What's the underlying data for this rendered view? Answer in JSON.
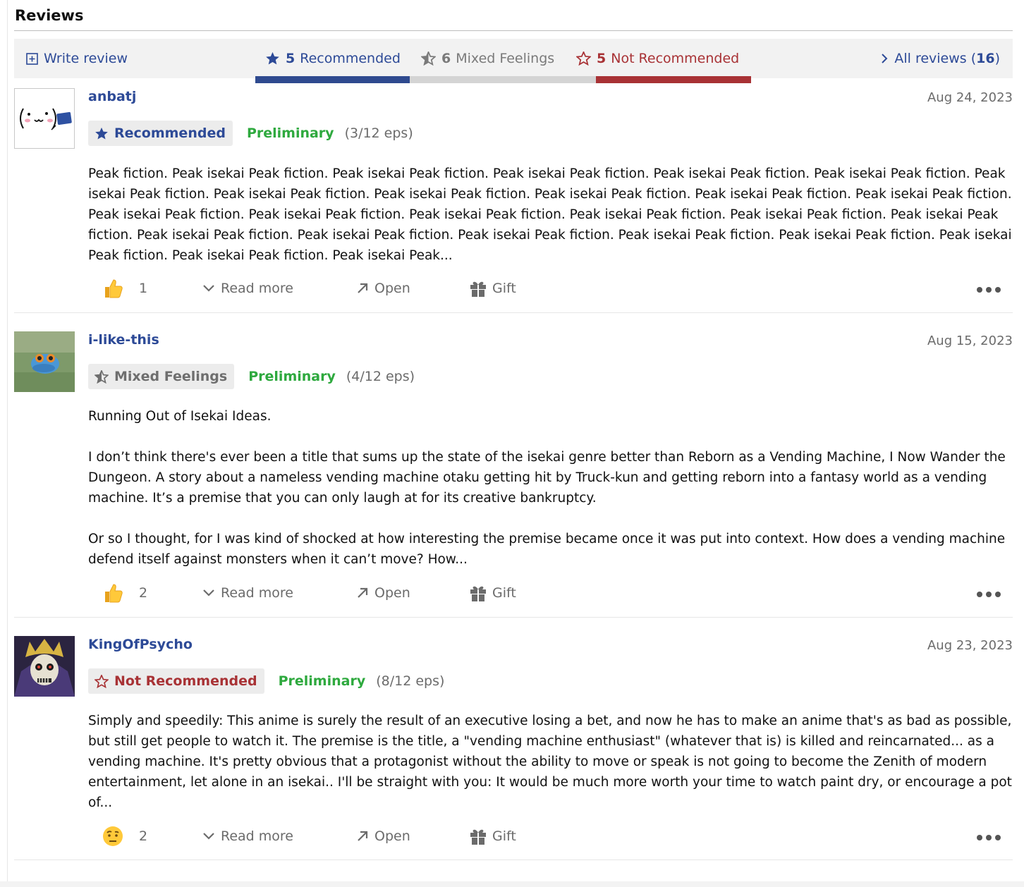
{
  "section_title": "Reviews",
  "toolbar": {
    "write_review": "Write review",
    "recommended": {
      "count": "5",
      "label": "Recommended"
    },
    "mixed": {
      "count": "6",
      "label": "Mixed Feelings"
    },
    "not_recommended": {
      "count": "5",
      "label": "Not Recommended"
    },
    "all_reviews": {
      "label": "All reviews (",
      "count": "16",
      "close": ")"
    }
  },
  "colors": {
    "recommended": "#2d4a97",
    "mixed": "#7a7a7a",
    "not_recommended": "#a83235",
    "preliminary": "#2ea93e"
  },
  "reviews": [
    {
      "username": "anbatj",
      "date": "Aug 24, 2023",
      "tag": "Recommended",
      "preliminary": "Preliminary",
      "eps": "(3/12 eps)",
      "paragraphs": [
        "Peak fiction. Peak isekai Peak fiction. Peak isekai Peak fiction. Peak isekai Peak fiction. Peak isekai Peak fiction. Peak isekai Peak fiction. Peak isekai Peak fiction. Peak isekai Peak fiction. Peak isekai Peak fiction. Peak isekai Peak fiction. Peak isekai Peak fiction. Peak isekai Peak fiction. Peak isekai Peak fiction. Peak isekai Peak fiction. Peak isekai Peak fiction. Peak isekai Peak fiction. Peak isekai Peak fiction. Peak isekai Peak fiction. Peak isekai Peak fiction. Peak isekai Peak fiction. Peak isekai Peak fiction. Peak isekai Peak fiction. Peak isekai Peak fiction. Peak isekai Peak fiction. Peak isekai Peak fiction. Peak isekai Peak..."
      ],
      "reaction_icon": "thumbs-up-icon",
      "reaction_count": "1"
    },
    {
      "username": "i-like-this",
      "date": "Aug 15, 2023",
      "tag": "Mixed Feelings",
      "preliminary": "Preliminary",
      "eps": "(4/12 eps)",
      "paragraphs": [
        "Running Out of Isekai Ideas.",
        "I don’t think there's ever been a title that sums up the state of the isekai genre better than Reborn as a Vending Machine, I Now Wander the Dungeon. A story about a nameless vending machine otaku getting hit by Truck-kun and getting reborn into a fantasy world as a vending machine. It’s a premise that you can only laugh at for its creative bankruptcy.",
        "Or so I thought, for I was kind of shocked at how interesting the premise became once it was put into context. How does a vending machine defend itself against monsters when it can’t move? How..."
      ],
      "reaction_icon": "thumbs-up-icon",
      "reaction_count": "2"
    },
    {
      "username": "KingOfPsycho",
      "date": "Aug 23, 2023",
      "tag": "Not Recommended",
      "preliminary": "Preliminary",
      "eps": "(8/12 eps)",
      "paragraphs": [
        "Simply and speedily: This anime is surely the result of an executive losing a bet, and now he has to make an anime that's as bad as possible, but still get people to watch it. The premise is the title, a \"vending machine enthusiast\" (whatever that is) is killed and reincarnated... as a vending machine. It's pretty obvious that a protagonist without the ability to move or speak is not going to become the Zenith of modern entertainment, let alone in an isekai.. I'll be straight with you: It would be much more worth your time to watch paint dry, or encourage a pot of..."
      ],
      "reaction_icon": "raised-eyebrow-face-icon",
      "reaction_count": "2"
    }
  ],
  "actions": {
    "read_more": "Read more",
    "open": "Open",
    "gift": "Gift"
  }
}
